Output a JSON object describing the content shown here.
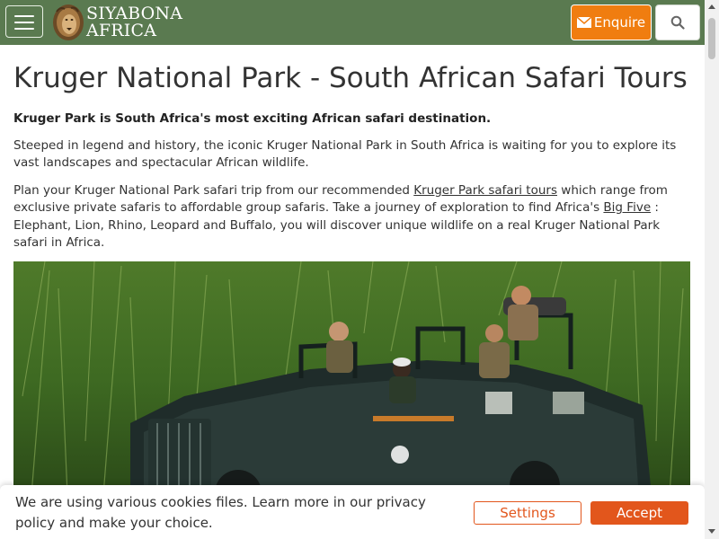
{
  "colors": {
    "header_bg": "#5a7a50",
    "enquire_bg": "#f07d10",
    "cookie_accent": "#e2561c"
  },
  "header": {
    "menu_icon": "hamburger-icon",
    "logo_line1": "SIYABONA",
    "logo_line2": "AFRICA",
    "enquire_icon": "envelope-icon",
    "enquire_label": "Enquire",
    "search_icon": "search-icon"
  },
  "main": {
    "title": "Kruger National Park - South African Safari Tours",
    "lead": "Kruger Park is South Africa's most exciting African safari destination.",
    "para1": "Steeped in legend and history, the iconic Kruger National Park in South Africa is waiting for you to explore its vast landscapes and spectacular African wildlife.",
    "para2_a": "Plan your Kruger National Park safari trip from our recommended ",
    "para2_link1": "Kruger Park safari tours",
    "para2_b": " which range from exclusive private safaris to affordable group safaris. Take a journey of exploration to find Africa's ",
    "para2_link2": "Big Five",
    "para2_c": " : Elephant, Lion, Rhino, Leopard and Buffalo, you will discover unique wildlife on a real Kruger National Park safari in Africa."
  },
  "cookie": {
    "text": "We are using various cookies files. Learn more in our privacy policy and make your choice.",
    "settings_label": "Settings",
    "accept_label": "Accept"
  }
}
